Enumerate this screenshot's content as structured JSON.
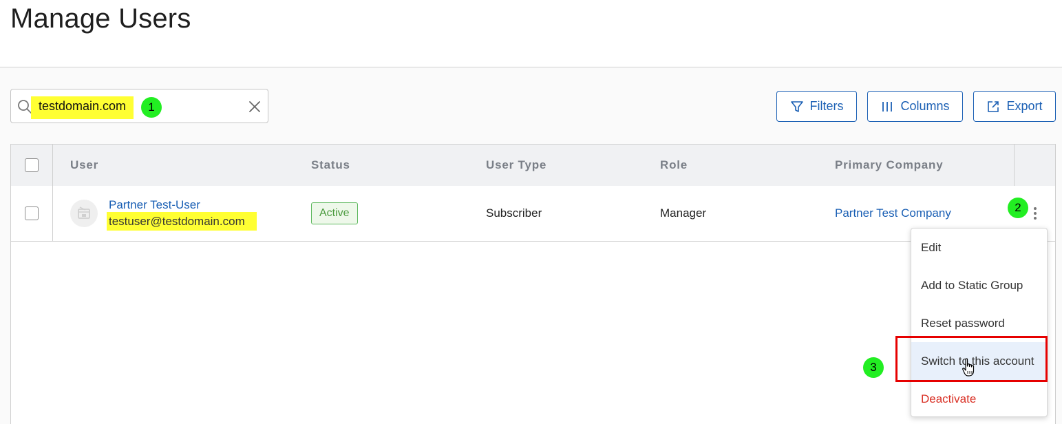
{
  "page": {
    "title": "Manage Users"
  },
  "search": {
    "value": "testdomain.com"
  },
  "toolbar": {
    "filters_label": "Filters",
    "columns_label": "Columns",
    "export_label": "Export"
  },
  "table": {
    "headers": {
      "user": "User",
      "status": "Status",
      "user_type": "User Type",
      "role": "Role",
      "primary_company": "Primary Company"
    },
    "rows": [
      {
        "name": "Partner Test-User",
        "email": "testuser@testdomain.com",
        "status": "Active",
        "user_type": "Subscriber",
        "role": "Manager",
        "primary_company": "Partner Test Company"
      }
    ]
  },
  "row_menu": {
    "items": [
      {
        "label": "Edit"
      },
      {
        "label": "Add to Static Group"
      },
      {
        "label": "Reset password"
      },
      {
        "label": "Switch to this account"
      },
      {
        "label": "Deactivate"
      }
    ]
  },
  "annotations": {
    "step1": "1",
    "step2": "2",
    "step3": "3"
  },
  "colors": {
    "link": "#1a5fb4",
    "highlight": "#ffff33",
    "step_badge": "#22ee22",
    "status_active": "#4a9a3d",
    "danger": "#d93025",
    "annotation_box": "#e60000"
  },
  "icons": {
    "search": "search-icon",
    "clear": "close-icon",
    "filters": "filter-icon",
    "columns": "columns-icon",
    "export": "external-link-icon",
    "more": "more-vertical-icon",
    "avatar": "user-placeholder-icon",
    "cursor": "hand-pointer-icon"
  }
}
